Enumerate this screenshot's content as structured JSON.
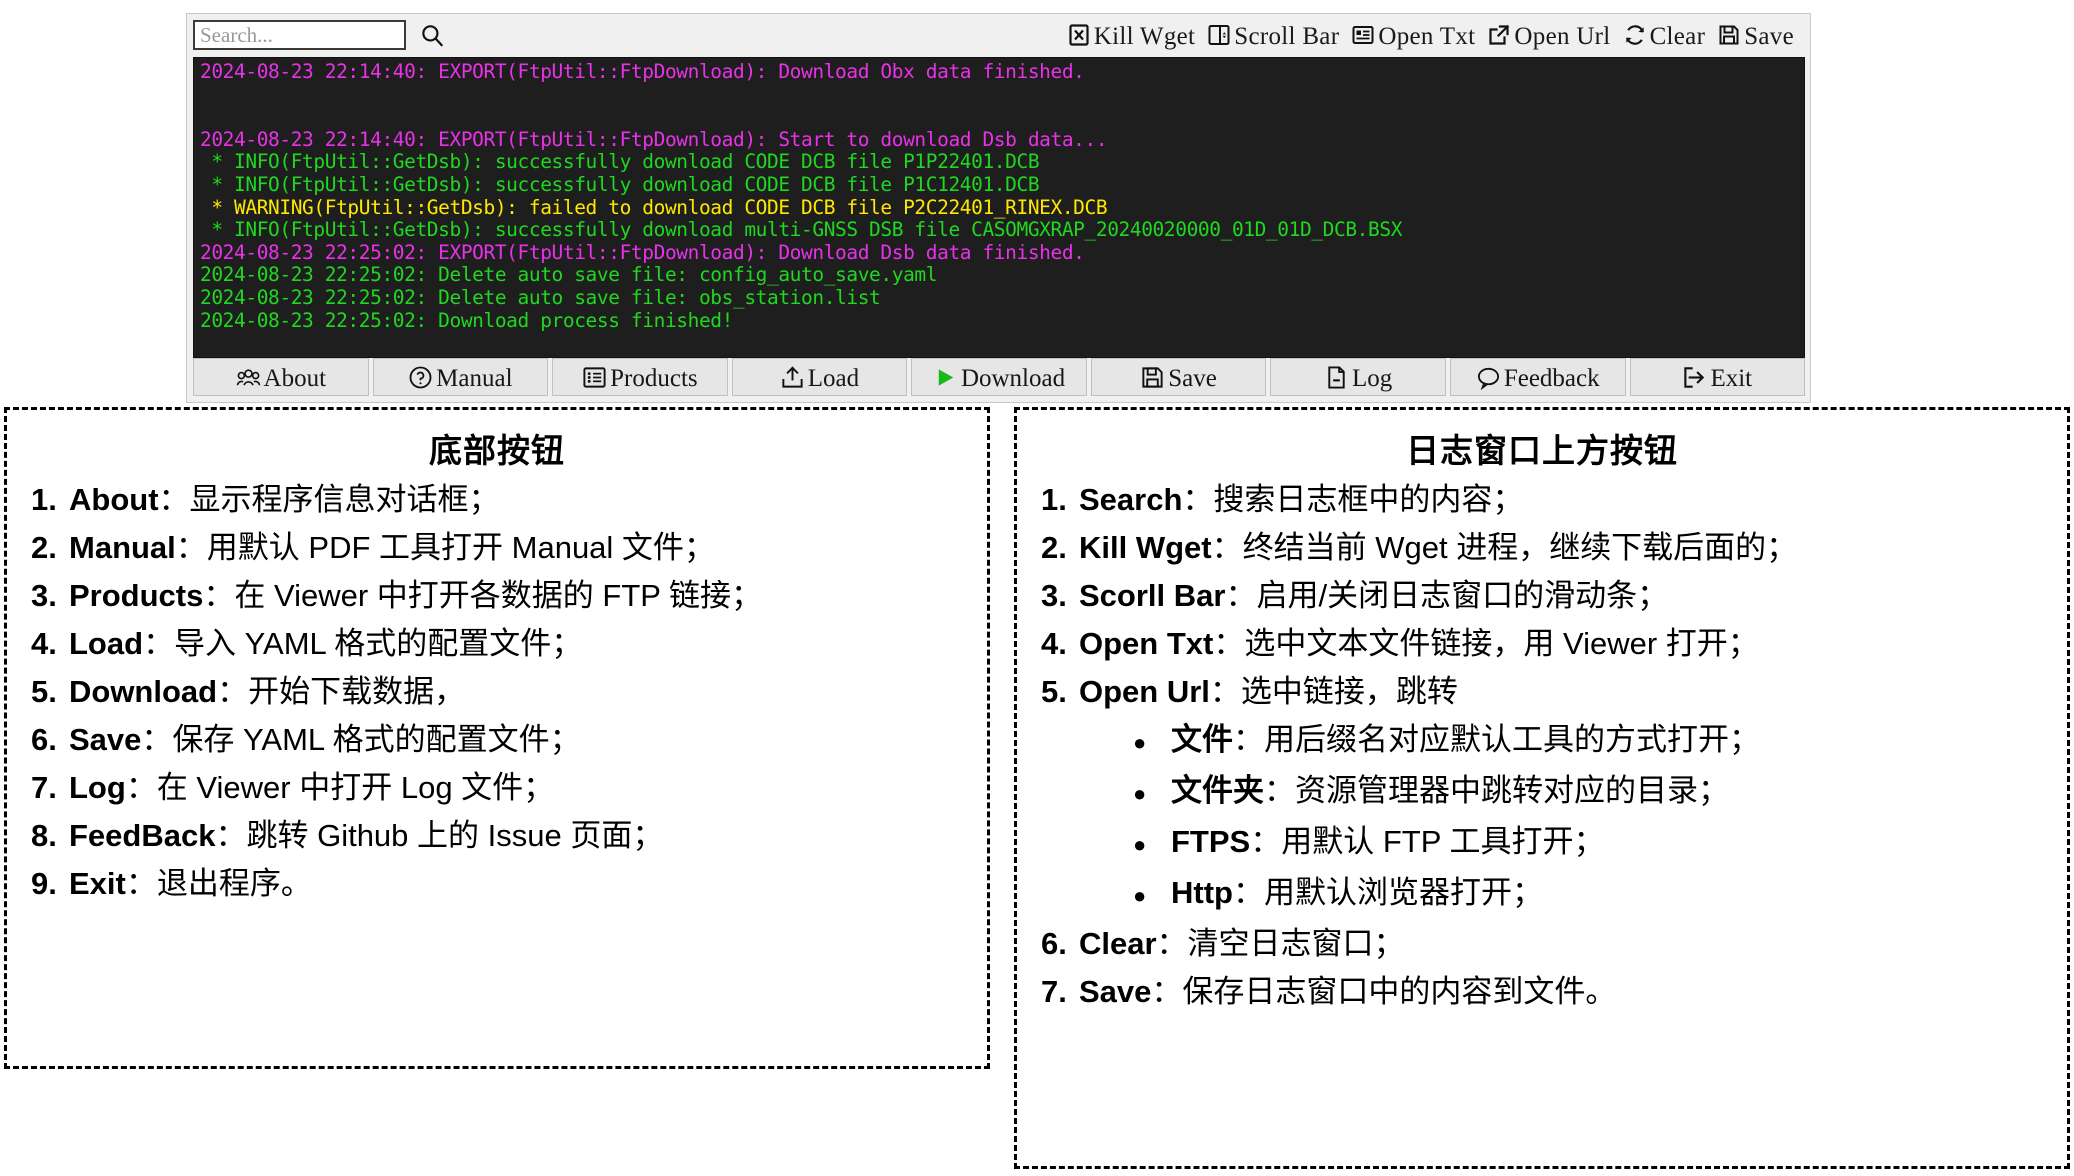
{
  "app": {
    "search": {
      "placeholder": "Search...",
      "value": ""
    },
    "toolbar_buttons": [
      {
        "label": "Kill Wget",
        "icon": "kill-wget-icon"
      },
      {
        "label": "Scroll Bar",
        "icon": "scroll-bar-icon"
      },
      {
        "label": "Open Txt",
        "icon": "open-txt-icon"
      },
      {
        "label": "Open Url",
        "icon": "open-url-icon"
      },
      {
        "label": "Clear",
        "icon": "clear-refresh-icon"
      },
      {
        "label": "Save",
        "icon": "save-floppy-icon"
      }
    ],
    "search_icon": "search-icon",
    "log_lines": [
      {
        "text": "2024-08-23 22:14:40: EXPORT(FtpUtil::FtpDownload): Download Obx data finished.",
        "color": "#e832e8"
      },
      {
        "text": "",
        "color": "#1e1e1e"
      },
      {
        "text": "",
        "color": "#1e1e1e"
      },
      {
        "text": "2024-08-23 22:14:40: EXPORT(FtpUtil::FtpDownload): Start to download Dsb data...",
        "color": "#e832e8"
      },
      {
        "text": " * INFO(FtpUtil::GetDsb): successfully download CODE DCB file P1P22401.DCB",
        "color": "#1fd81f"
      },
      {
        "text": " * INFO(FtpUtil::GetDsb): successfully download CODE DCB file P1C12401.DCB",
        "color": "#1fd81f"
      },
      {
        "text": " * WARNING(FtpUtil::GetDsb): failed to download CODE DCB file P2C22401_RINEX.DCB",
        "color": "#ffe800"
      },
      {
        "text": " * INFO(FtpUtil::GetDsb): successfully download multi-GNSS DSB file CASOMGXRAP_20240020000_01D_01D_DCB.BSX",
        "color": "#1fd81f"
      },
      {
        "text": "2024-08-23 22:25:02: EXPORT(FtpUtil::FtpDownload): Download Dsb data finished.",
        "color": "#e832e8"
      },
      {
        "text": "2024-08-23 22:25:02: Delete auto save file: config_auto_save.yaml",
        "color": "#1fd81f"
      },
      {
        "text": "2024-08-23 22:25:02: Delete auto save file: obs_station.list",
        "color": "#1fd81f"
      },
      {
        "text": "2024-08-23 22:25:02: Download process finished!",
        "color": "#1fd81f"
      }
    ],
    "bottom_buttons": [
      {
        "label": "About",
        "icon": "about-people-icon"
      },
      {
        "label": "Manual",
        "icon": "question-circle-icon"
      },
      {
        "label": "Products",
        "icon": "list-document-icon"
      },
      {
        "label": "Load",
        "icon": "upload-icon"
      },
      {
        "label": "Download",
        "icon": "play-triangle-icon"
      },
      {
        "label": "Save",
        "icon": "save-floppy-icon"
      },
      {
        "label": "Log",
        "icon": "file-minus-icon"
      },
      {
        "label": "Feedback",
        "icon": "speech-bubble-icon"
      },
      {
        "label": "Exit",
        "icon": "exit-arrow-icon"
      }
    ]
  },
  "panels": {
    "bottom": {
      "title": "底部按钮",
      "items": [
        {
          "term": "About",
          "desc": "：显示程序信息对话框；"
        },
        {
          "term": "Manual",
          "desc": "：用默认 PDF 工具打开 Manual 文件；"
        },
        {
          "term": "Products",
          "desc": "：在 Viewer 中打开各数据的 FTP 链接；"
        },
        {
          "term": "Load",
          "desc": "：导入 YAML 格式的配置文件；"
        },
        {
          "term": "Download",
          "desc": "：开始下载数据，"
        },
        {
          "term": "Save",
          "desc": "：保存 YAML 格式的配置文件；"
        },
        {
          "term": "Log",
          "desc": "：在 Viewer 中打开 Log 文件；"
        },
        {
          "term": "FeedBack",
          "desc": "：跳转 Github 上的 Issue 页面；"
        },
        {
          "term": "Exit",
          "desc": "：退出程序。"
        }
      ]
    },
    "toolbar": {
      "title": "日志窗口上方按钮",
      "items": [
        {
          "term": "Search",
          "desc": "：搜索日志框中的内容；"
        },
        {
          "term": "Kill Wget",
          "desc": "：终结当前 Wget 进程，继续下载后面的；"
        },
        {
          "term": "Scorll Bar",
          "desc": "：启用/关闭日志窗口的滑动条；"
        },
        {
          "term": "Open Txt",
          "desc": "：选中文本文件链接，用 Viewer 打开；"
        },
        {
          "term": "Open Url",
          "desc": "：选中链接，跳转",
          "sub": [
            {
              "term": "文件",
              "desc": "：用后缀名对应默认工具的方式打开；"
            },
            {
              "term": "文件夹",
              "desc": "：资源管理器中跳转对应的目录；"
            },
            {
              "term": "FTPS",
              "desc": "：用默认 FTP 工具打开；"
            },
            {
              "term": "Http",
              "desc": "：用默认浏览器打开；"
            }
          ]
        },
        {
          "term": "Clear",
          "desc": "：清空日志窗口；"
        },
        {
          "term": "Save",
          "desc": "：保存日志窗口中的内容到文件。"
        }
      ]
    }
  }
}
